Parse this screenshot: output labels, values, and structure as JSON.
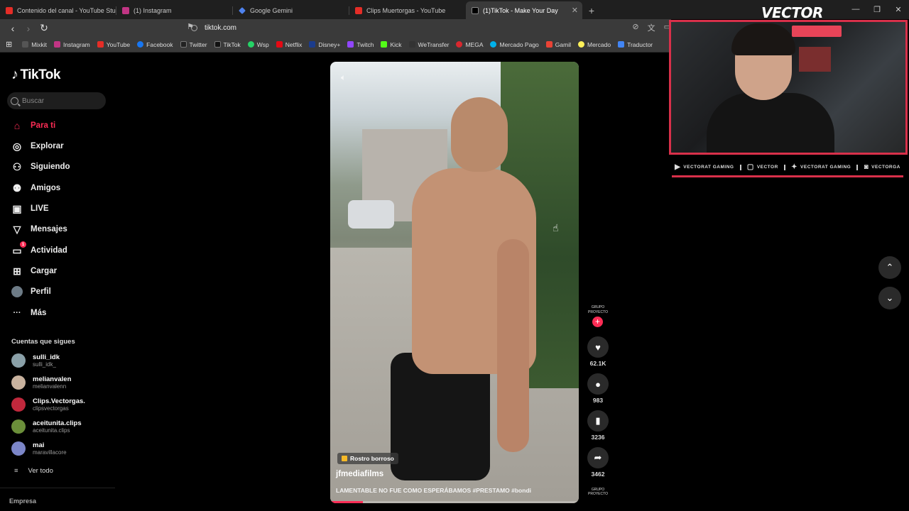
{
  "browser": {
    "tabs": [
      {
        "title": "Contenido del canal - YouTube Studio",
        "color": "#e52d27"
      },
      {
        "title": "(1) Instagram",
        "color": "#c13584"
      },
      {
        "title": "Google Gemini",
        "color": "#4e82ee"
      },
      {
        "title": "Clips Muertorgas - YouTube",
        "color": "#e52d27"
      },
      {
        "title": "(1)TikTok - Make Your Day",
        "color": "#000000"
      }
    ],
    "new_tab": "+",
    "url": "tiktok.com",
    "bookmarks": [
      {
        "label": "Mixkit",
        "color": "#555555"
      },
      {
        "label": "Instagram",
        "color": "#c13584"
      },
      {
        "label": "YouTube",
        "color": "#e52d27"
      },
      {
        "label": "Facebook",
        "color": "#1877f2"
      },
      {
        "label": "Twitter",
        "color": "#222222"
      },
      {
        "label": "TikTok",
        "color": "#111111"
      },
      {
        "label": "Wsp",
        "color": "#25d366"
      },
      {
        "label": "Netflix",
        "color": "#e50914"
      },
      {
        "label": "Disney+",
        "color": "#1b3c8c"
      },
      {
        "label": "Twitch",
        "color": "#9146ff"
      },
      {
        "label": "Kick",
        "color": "#53fc18"
      },
      {
        "label": "WeTransfer",
        "color": "#333333"
      },
      {
        "label": "MEGA",
        "color": "#d9272e"
      },
      {
        "label": "Mercado Pago",
        "color": "#00b1ea"
      },
      {
        "label": "Gamil",
        "color": "#ea4335"
      },
      {
        "label": "Mercado",
        "color": "#fff159"
      },
      {
        "label": "Traductor",
        "color": "#4285f4"
      }
    ]
  },
  "tiktok": {
    "logo": "TikTok",
    "search_placeholder": "Buscar",
    "nav": [
      {
        "label": "Para ti",
        "icon": "home-icon",
        "glyph": "⌂"
      },
      {
        "label": "Explorar",
        "icon": "compass-icon",
        "glyph": "◎"
      },
      {
        "label": "Siguiendo",
        "icon": "following-icon",
        "glyph": "⚇"
      },
      {
        "label": "Amigos",
        "icon": "friends-icon",
        "glyph": "⚉"
      },
      {
        "label": "LIVE",
        "icon": "live-icon",
        "glyph": "▣"
      },
      {
        "label": "Mensajes",
        "icon": "messages-icon",
        "glyph": "▽"
      },
      {
        "label": "Actividad",
        "icon": "activity-icon",
        "glyph": "▭",
        "badge": "1"
      },
      {
        "label": "Cargar",
        "icon": "upload-icon",
        "glyph": "⊞"
      },
      {
        "label": "Perfil",
        "icon": "profile-avatar-icon",
        "glyph": "●"
      },
      {
        "label": "Más",
        "icon": "more-icon",
        "glyph": "···"
      }
    ],
    "following_header": "Cuentas que sigues",
    "following": [
      {
        "name": "sulli_idk",
        "handle": "sulli_idk_",
        "color": "#8aa0a8"
      },
      {
        "name": "melianvalen",
        "handle": "melianvalenn",
        "color": "#c8b29e"
      },
      {
        "name": "Clips.Vectorgas.",
        "handle": "clipsvectorgas",
        "color": "#c0283c"
      },
      {
        "name": "aceitunita.clips",
        "handle": "aceitunita.clips",
        "color": "#6b8f3a"
      },
      {
        "name": "mai",
        "handle": "maravillacore",
        "color": "#7c86c8"
      }
    ],
    "see_all": "Ver todo",
    "footer": "Empresa",
    "accent": "#fe2c55"
  },
  "video": {
    "blur_badge": "Rostro borroso",
    "username": "jfmediafilms",
    "caption": "LAMENTABLE NO FUE COMO ESPERÁBAMOS #PRESTAMO #bondi",
    "progress": 0.13,
    "author_avatar_text": "GRUPO PROYECTO",
    "likes": "62.1K",
    "comments": "983",
    "saves": "3236",
    "shares": "3462",
    "follow": "+"
  },
  "scroll": {
    "up": "⌃",
    "down": "⌄"
  },
  "stream_overlay": {
    "title": "VECTOR",
    "socials": [
      {
        "icon": "youtube-icon",
        "glyph": "▶",
        "label": "VECTORAT GAMING"
      },
      {
        "icon": "twitch-icon",
        "glyph": "▢",
        "label": "VECTOR"
      },
      {
        "icon": "twitter-icon",
        "glyph": "✦",
        "label": "VECTORAT GAMING"
      },
      {
        "icon": "instagram-icon",
        "glyph": "◙",
        "label": "VECTORGA"
      }
    ],
    "accent": "#d8304a"
  }
}
